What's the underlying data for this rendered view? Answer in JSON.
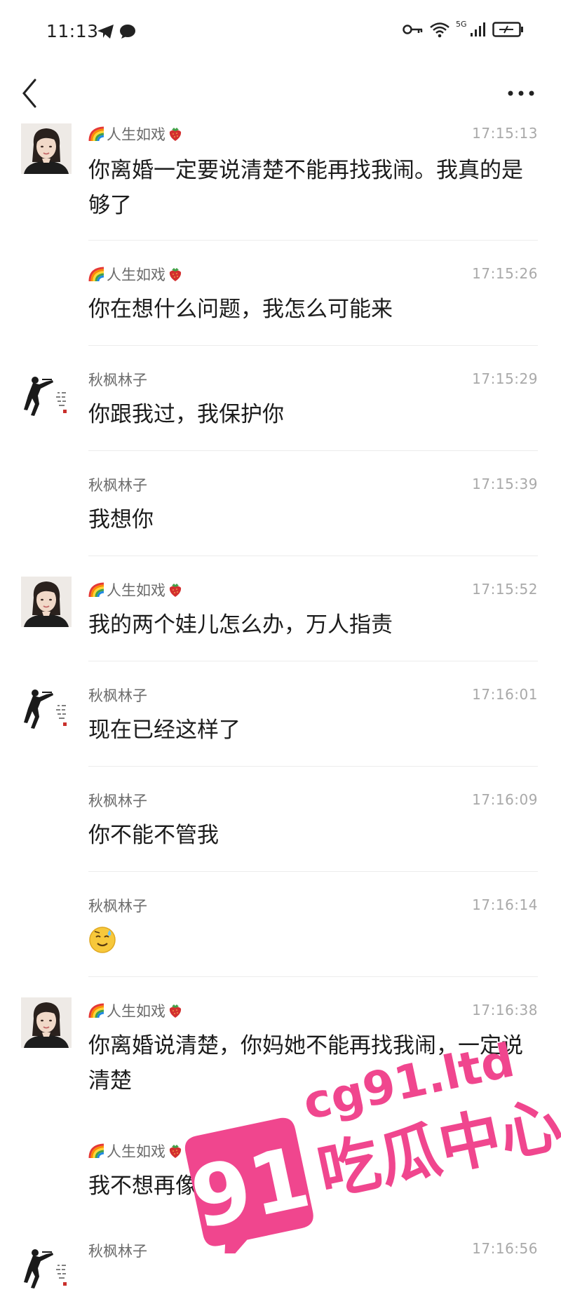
{
  "status_bar": {
    "time": "11:13",
    "network": "5G"
  },
  "nav": {
    "back_icon": "chevron-left-icon",
    "more_icon": "more-horizontal-icon"
  },
  "messages": [
    {
      "sender": "人生如戏",
      "time": "17:15:13",
      "text": "你离婚一定要说清楚不能再找我闹。我真的是够了",
      "avatar": "woman"
    },
    {
      "sender": "人生如戏",
      "time": "17:15:26",
      "text": "你在想什么问题，我怎么可能来",
      "avatar": null
    },
    {
      "sender": "秋枫林子",
      "time": "17:15:29",
      "text": "你跟我过，我保护你",
      "avatar": "man"
    },
    {
      "sender": "秋枫林子",
      "time": "17:15:39",
      "text": "我想你",
      "avatar": null
    },
    {
      "sender": "人生如戏",
      "time": "17:15:52",
      "text": "我的两个娃儿怎么办，万人指责",
      "avatar": "woman"
    },
    {
      "sender": "秋枫林子",
      "time": "17:16:01",
      "text": "现在已经这样了",
      "avatar": "man"
    },
    {
      "sender": "秋枫林子",
      "time": "17:16:09",
      "text": "你不能不管我",
      "avatar": null
    },
    {
      "sender": "秋枫林子",
      "time": "17:16:14",
      "text": "",
      "avatar": null,
      "emoji": "sweat-smile-emoji"
    },
    {
      "sender": "人生如戏",
      "time": "17:16:38",
      "text": "你离婚说清楚，你妈她不能再找我闹，一定说清楚",
      "avatar": "woman"
    },
    {
      "sender": "人生如戏",
      "time": "",
      "text": "我不想再像今天这样",
      "avatar": null
    },
    {
      "sender": "秋枫林子",
      "time": "17:16:56",
      "text": "",
      "avatar": "man"
    }
  ],
  "watermark": {
    "number": "91",
    "domain": "cg91.ltd",
    "title": "吃瓜中心",
    "color": "#f0468e"
  }
}
